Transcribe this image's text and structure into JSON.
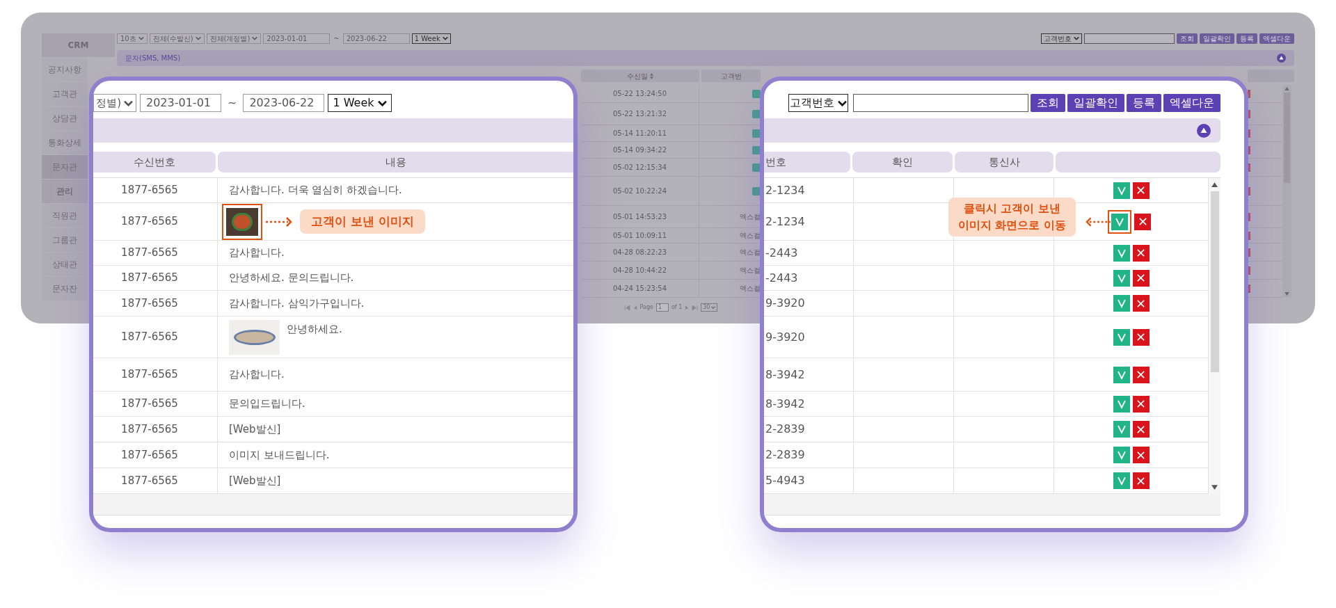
{
  "sidebar": [
    {
      "label": "CRM",
      "kind": "header"
    },
    {
      "label": "공지사항",
      "kind": "item",
      "selected": false
    },
    {
      "label": "고객관",
      "kind": "item",
      "selected": false
    },
    {
      "label": "상담관",
      "kind": "item",
      "selected": false
    },
    {
      "label": "통화상세",
      "kind": "item",
      "selected": false
    },
    {
      "label": "문자관",
      "kind": "item",
      "selected": true
    },
    {
      "label": "관리",
      "kind": "header"
    },
    {
      "label": "직원관",
      "kind": "item",
      "selected": false
    },
    {
      "label": "그룹관",
      "kind": "item",
      "selected": false
    },
    {
      "label": "상태관",
      "kind": "item",
      "selected": false
    },
    {
      "label": "문자잔",
      "kind": "item",
      "selected": false
    }
  ],
  "toolbar": {
    "selects": [
      "10초",
      "전체(수발신)",
      "전체(계정별)"
    ],
    "date_from": "2023-01-01",
    "separator": "~",
    "date_to": "2023-06-22",
    "period": "1 Week",
    "search_type": "고객번호",
    "buttons": [
      "조회",
      "일괄확인",
      "등록",
      "엑셀다운"
    ]
  },
  "section": {
    "title": "문자(SMS, MMS)",
    "expanded": true
  },
  "table": {
    "columns": [
      "수신일",
      "고객번"
    ],
    "rows": [
      {
        "received": "05-22 13:24:50",
        "kind": "badge"
      },
      {
        "received": "05-22 13:21:32",
        "kind": "badge"
      },
      {
        "received": "05-14 11:20:11",
        "kind": "badge"
      },
      {
        "received": "05-14 09:34:22",
        "kind": "badge"
      },
      {
        "received": "05-02 12:15:34",
        "kind": "badge"
      },
      {
        "received": "05-02 10:22:24",
        "kind": "badge"
      },
      {
        "received": "05-01 14:53:23",
        "kind": "text",
        "customer": "엑스컬"
      },
      {
        "received": "05-01 10:09:11",
        "kind": "text",
        "customer": "엑스컬"
      },
      {
        "received": "04-28 08:22:23",
        "kind": "text",
        "customer": "엑스컬"
      },
      {
        "received": "04-28 10:44:22",
        "kind": "text",
        "customer": "엑스컬"
      },
      {
        "received": "04-24 15:23:54",
        "kind": "text",
        "customer": "엑스컬"
      }
    ]
  },
  "pagination": {
    "label": "Page",
    "page": "1",
    "of": "of 1",
    "per_page": "30"
  },
  "left_panel": {
    "filter": "정별)",
    "date_from": "2023-01-01",
    "separator": "~",
    "date_to": "2023-06-22",
    "period": "1 Week",
    "columns": [
      "수신번호",
      "내용"
    ],
    "callout": "고객이 보낸 이미지",
    "rows": [
      {
        "number": "1877-6565",
        "kind": "text",
        "text": "감사합니다. 더욱 열심히 하겠습니다.",
        "highlighted": false
      },
      {
        "number": "1877-6565",
        "kind": "image",
        "highlighted": true
      },
      {
        "number": "1877-6565",
        "kind": "text",
        "text": "감사합니다.",
        "highlighted": false
      },
      {
        "number": "1877-6565",
        "kind": "text",
        "text": "안녕하세요. 문의드립니다.",
        "highlighted": false
      },
      {
        "number": "1877-6565",
        "kind": "text",
        "text": "감사합니다. 삼익가구입니다.",
        "highlighted": false
      },
      {
        "number": "1877-6565",
        "kind": "image_text",
        "text": "안녕하세요.",
        "highlighted": false
      },
      {
        "number": "1877-6565",
        "kind": "text",
        "text": "감사합니다.",
        "highlighted": false
      },
      {
        "number": "1877-6565",
        "kind": "text",
        "text": "문의입드립니다.",
        "highlighted": false
      },
      {
        "number": "1877-6565",
        "kind": "text",
        "text": "[Web발신]",
        "highlighted": false
      },
      {
        "number": "1877-6565",
        "kind": "text",
        "text": "이미지 보내드립니다.",
        "highlighted": false
      },
      {
        "number": "1877-6565",
        "kind": "text",
        "text": "[Web발신]",
        "highlighted": false
      }
    ]
  },
  "right_panel": {
    "search_type": "고객번호",
    "buttons": [
      "조회",
      "일괄확인",
      "등록",
      "엑셀다운"
    ],
    "expanded": true,
    "columns": [
      "번호",
      "확인",
      "통신사"
    ],
    "callout": [
      "클릭시 고객이 보낸",
      "이미지 화면으로 이동"
    ],
    "rows": [
      {
        "number": "2-1234",
        "highlighted": false
      },
      {
        "number": "2-1234",
        "highlighted": true
      },
      {
        "number": "-2443",
        "highlighted": false
      },
      {
        "number": "-2443",
        "highlighted": false
      },
      {
        "number": "9-3920",
        "highlighted": false
      },
      {
        "number": "9-3920",
        "highlighted": false
      },
      {
        "number": "8-3942",
        "highlighted": false
      },
      {
        "number": "8-3942",
        "highlighted": false
      },
      {
        "number": "2-2839",
        "highlighted": false
      },
      {
        "number": "2-2839",
        "highlighted": false
      },
      {
        "number": "5-4943",
        "highlighted": false
      }
    ]
  }
}
